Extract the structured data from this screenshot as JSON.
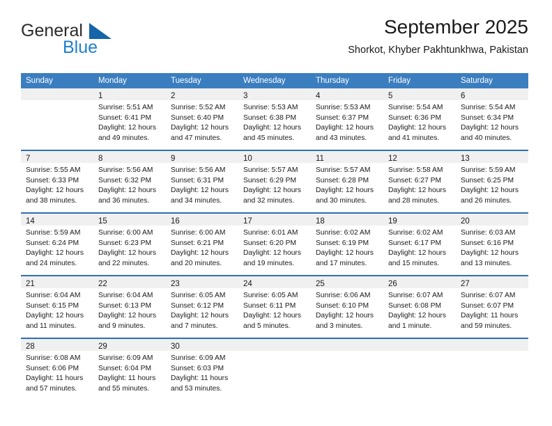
{
  "brand": {
    "name_top": "General",
    "name_bottom": "Blue",
    "mark_icon": "blue-triangle-logo-icon",
    "accent_color": "#1f7fd0",
    "text_color": "#2b2b2b"
  },
  "header": {
    "title": "September 2025",
    "subtitle": "Shorkot, Khyber Pakhtunkhwa, Pakistan"
  },
  "calendar": {
    "header_bg": "#3b7ec0",
    "week_divider_color": "#2f6fb0",
    "day_band_bg": "#f0f0f0",
    "weekdays": [
      "Sunday",
      "Monday",
      "Tuesday",
      "Wednesday",
      "Thursday",
      "Friday",
      "Saturday"
    ],
    "weeks": [
      [
        {
          "day": "",
          "lines": []
        },
        {
          "day": "1",
          "lines": [
            "Sunrise: 5:51 AM",
            "Sunset: 6:41 PM",
            "Daylight: 12 hours",
            "and 49 minutes."
          ]
        },
        {
          "day": "2",
          "lines": [
            "Sunrise: 5:52 AM",
            "Sunset: 6:40 PM",
            "Daylight: 12 hours",
            "and 47 minutes."
          ]
        },
        {
          "day": "3",
          "lines": [
            "Sunrise: 5:53 AM",
            "Sunset: 6:38 PM",
            "Daylight: 12 hours",
            "and 45 minutes."
          ]
        },
        {
          "day": "4",
          "lines": [
            "Sunrise: 5:53 AM",
            "Sunset: 6:37 PM",
            "Daylight: 12 hours",
            "and 43 minutes."
          ]
        },
        {
          "day": "5",
          "lines": [
            "Sunrise: 5:54 AM",
            "Sunset: 6:36 PM",
            "Daylight: 12 hours",
            "and 41 minutes."
          ]
        },
        {
          "day": "6",
          "lines": [
            "Sunrise: 5:54 AM",
            "Sunset: 6:34 PM",
            "Daylight: 12 hours",
            "and 40 minutes."
          ]
        }
      ],
      [
        {
          "day": "7",
          "lines": [
            "Sunrise: 5:55 AM",
            "Sunset: 6:33 PM",
            "Daylight: 12 hours",
            "and 38 minutes."
          ]
        },
        {
          "day": "8",
          "lines": [
            "Sunrise: 5:56 AM",
            "Sunset: 6:32 PM",
            "Daylight: 12 hours",
            "and 36 minutes."
          ]
        },
        {
          "day": "9",
          "lines": [
            "Sunrise: 5:56 AM",
            "Sunset: 6:31 PM",
            "Daylight: 12 hours",
            "and 34 minutes."
          ]
        },
        {
          "day": "10",
          "lines": [
            "Sunrise: 5:57 AM",
            "Sunset: 6:29 PM",
            "Daylight: 12 hours",
            "and 32 minutes."
          ]
        },
        {
          "day": "11",
          "lines": [
            "Sunrise: 5:57 AM",
            "Sunset: 6:28 PM",
            "Daylight: 12 hours",
            "and 30 minutes."
          ]
        },
        {
          "day": "12",
          "lines": [
            "Sunrise: 5:58 AM",
            "Sunset: 6:27 PM",
            "Daylight: 12 hours",
            "and 28 minutes."
          ]
        },
        {
          "day": "13",
          "lines": [
            "Sunrise: 5:59 AM",
            "Sunset: 6:25 PM",
            "Daylight: 12 hours",
            "and 26 minutes."
          ]
        }
      ],
      [
        {
          "day": "14",
          "lines": [
            "Sunrise: 5:59 AM",
            "Sunset: 6:24 PM",
            "Daylight: 12 hours",
            "and 24 minutes."
          ]
        },
        {
          "day": "15",
          "lines": [
            "Sunrise: 6:00 AM",
            "Sunset: 6:23 PM",
            "Daylight: 12 hours",
            "and 22 minutes."
          ]
        },
        {
          "day": "16",
          "lines": [
            "Sunrise: 6:00 AM",
            "Sunset: 6:21 PM",
            "Daylight: 12 hours",
            "and 20 minutes."
          ]
        },
        {
          "day": "17",
          "lines": [
            "Sunrise: 6:01 AM",
            "Sunset: 6:20 PM",
            "Daylight: 12 hours",
            "and 19 minutes."
          ]
        },
        {
          "day": "18",
          "lines": [
            "Sunrise: 6:02 AM",
            "Sunset: 6:19 PM",
            "Daylight: 12 hours",
            "and 17 minutes."
          ]
        },
        {
          "day": "19",
          "lines": [
            "Sunrise: 6:02 AM",
            "Sunset: 6:17 PM",
            "Daylight: 12 hours",
            "and 15 minutes."
          ]
        },
        {
          "day": "20",
          "lines": [
            "Sunrise: 6:03 AM",
            "Sunset: 6:16 PM",
            "Daylight: 12 hours",
            "and 13 minutes."
          ]
        }
      ],
      [
        {
          "day": "21",
          "lines": [
            "Sunrise: 6:04 AM",
            "Sunset: 6:15 PM",
            "Daylight: 12 hours",
            "and 11 minutes."
          ]
        },
        {
          "day": "22",
          "lines": [
            "Sunrise: 6:04 AM",
            "Sunset: 6:13 PM",
            "Daylight: 12 hours",
            "and 9 minutes."
          ]
        },
        {
          "day": "23",
          "lines": [
            "Sunrise: 6:05 AM",
            "Sunset: 6:12 PM",
            "Daylight: 12 hours",
            "and 7 minutes."
          ]
        },
        {
          "day": "24",
          "lines": [
            "Sunrise: 6:05 AM",
            "Sunset: 6:11 PM",
            "Daylight: 12 hours",
            "and 5 minutes."
          ]
        },
        {
          "day": "25",
          "lines": [
            "Sunrise: 6:06 AM",
            "Sunset: 6:10 PM",
            "Daylight: 12 hours",
            "and 3 minutes."
          ]
        },
        {
          "day": "26",
          "lines": [
            "Sunrise: 6:07 AM",
            "Sunset: 6:08 PM",
            "Daylight: 12 hours",
            "and 1 minute."
          ]
        },
        {
          "day": "27",
          "lines": [
            "Sunrise: 6:07 AM",
            "Sunset: 6:07 PM",
            "Daylight: 11 hours",
            "and 59 minutes."
          ]
        }
      ],
      [
        {
          "day": "28",
          "lines": [
            "Sunrise: 6:08 AM",
            "Sunset: 6:06 PM",
            "Daylight: 11 hours",
            "and 57 minutes."
          ]
        },
        {
          "day": "29",
          "lines": [
            "Sunrise: 6:09 AM",
            "Sunset: 6:04 PM",
            "Daylight: 11 hours",
            "and 55 minutes."
          ]
        },
        {
          "day": "30",
          "lines": [
            "Sunrise: 6:09 AM",
            "Sunset: 6:03 PM",
            "Daylight: 11 hours",
            "and 53 minutes."
          ]
        },
        {
          "day": "",
          "lines": []
        },
        {
          "day": "",
          "lines": []
        },
        {
          "day": "",
          "lines": []
        },
        {
          "day": "",
          "lines": []
        }
      ]
    ]
  }
}
